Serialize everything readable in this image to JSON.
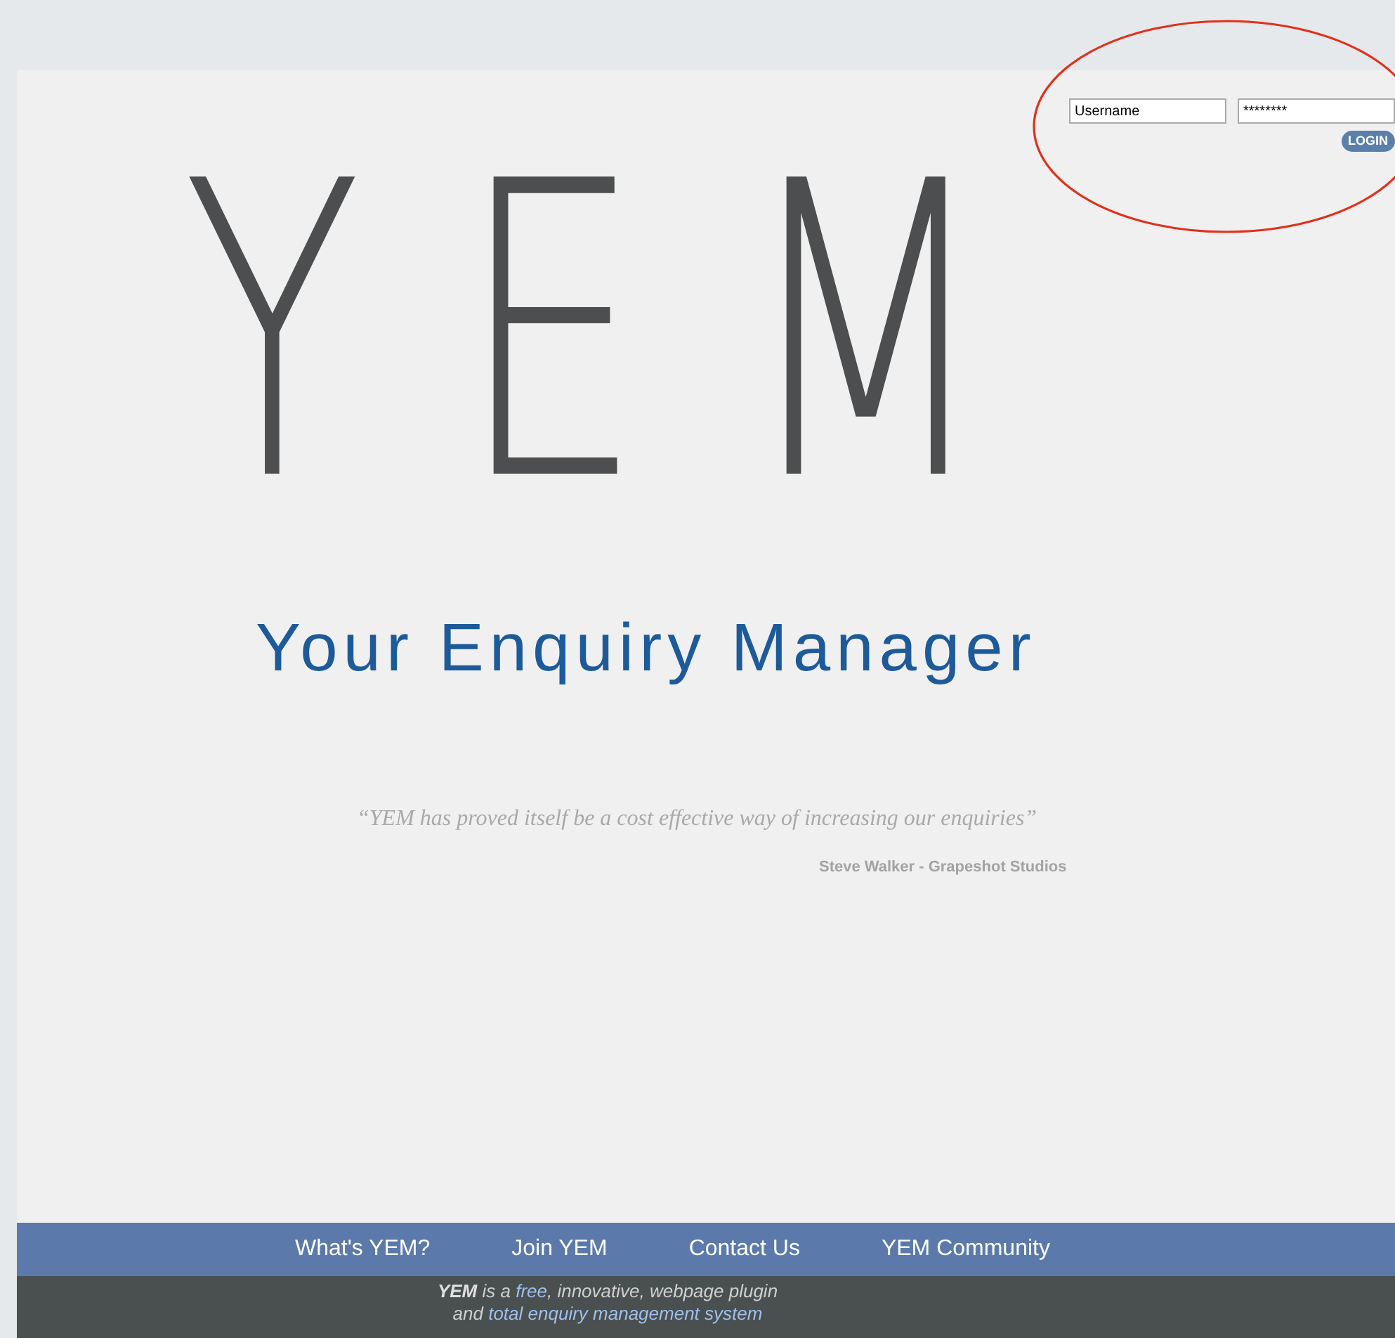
{
  "login": {
    "username": {
      "value": "Username"
    },
    "password": {
      "value": "********"
    },
    "button": "LOGIN"
  },
  "logo": {
    "mark": "YEM",
    "tagline": "Your Enquiry Manager"
  },
  "testimonial": {
    "quote": "“YEM has proved itself be a cost effective way of increasing our enquiries”",
    "author": "Steve Walker - Grapeshot Studios"
  },
  "nav": [
    "What's YEM?",
    "Join YEM",
    "Contact Us",
    "YEM Community"
  ],
  "footer": {
    "lines": [
      [
        {
          "kind": "bold",
          "text": "YEM"
        },
        {
          "kind": "plain",
          "text": " is a "
        },
        {
          "kind": "highlight",
          "text": "free"
        },
        {
          "kind": "plain",
          "text": ", innovative, webpage plugin"
        }
      ],
      [
        {
          "kind": "plain",
          "text": "and "
        },
        {
          "kind": "highlight",
          "text": "total enquiry management system"
        }
      ]
    ]
  }
}
